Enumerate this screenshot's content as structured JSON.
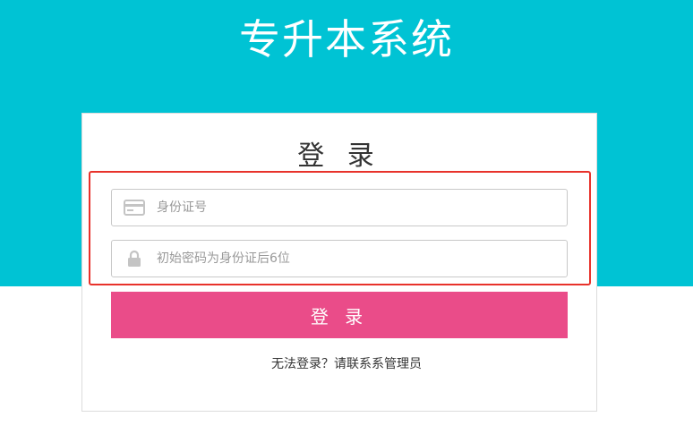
{
  "header": {
    "app_title": "专升本系统"
  },
  "login": {
    "heading": "登 录",
    "id_field": {
      "icon": "id-card-icon",
      "placeholder": "身份证号",
      "value": ""
    },
    "password_field": {
      "icon": "lock-icon",
      "placeholder": "初始密码为身份证后6位",
      "value": ""
    },
    "submit_label": "登 录",
    "help_text": "无法登录？请联系系管理员"
  },
  "colors": {
    "banner": "#00c3d4",
    "button": "#ea4c89",
    "highlight": "#e8322b"
  }
}
